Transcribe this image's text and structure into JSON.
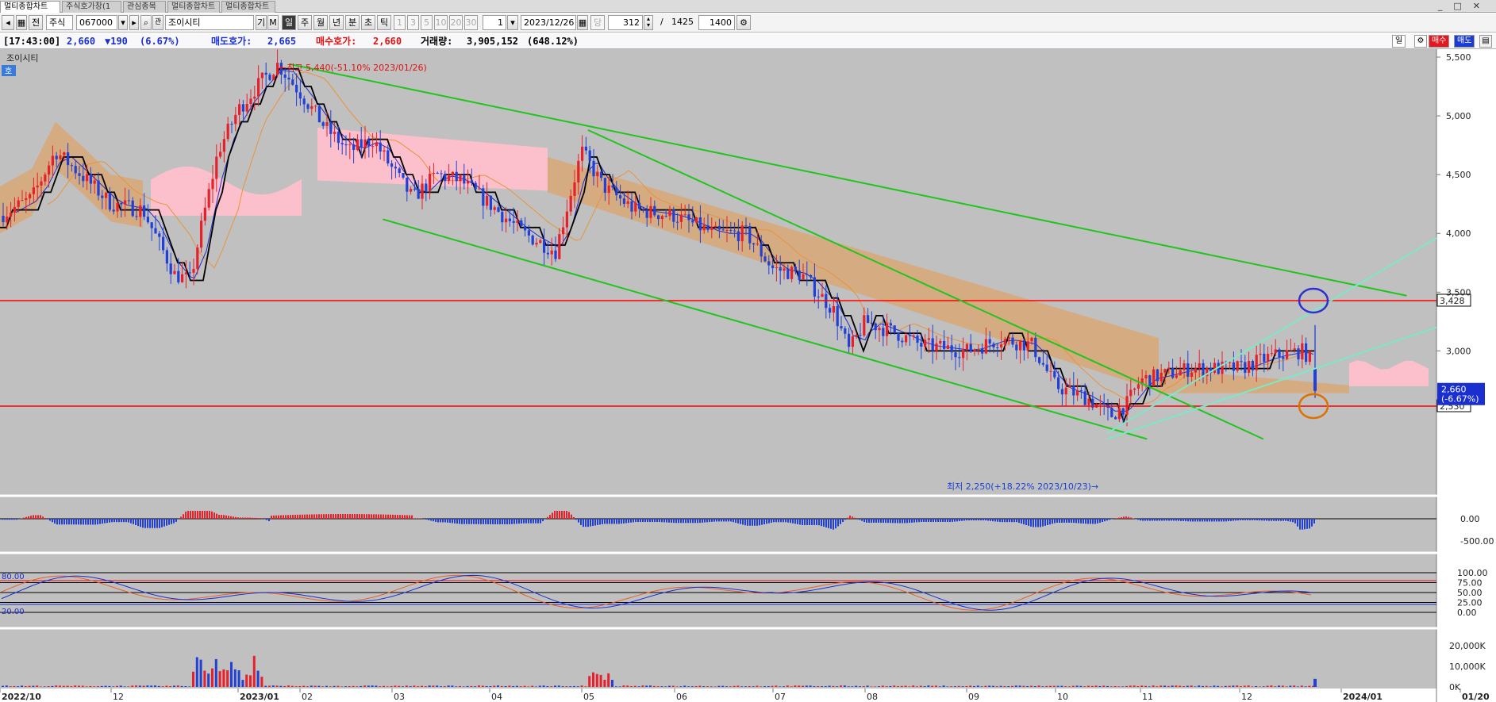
{
  "tabs": [
    {
      "label": "멀티종합차트"
    },
    {
      "label": "주식호가창(1"
    },
    {
      "label": "관심종목"
    },
    {
      "label": "멀티종합차트"
    },
    {
      "label": "멀티종합차트"
    }
  ],
  "toolbar": {
    "prev_label": "전",
    "market": "주식",
    "code": "067000",
    "name": "조이시티",
    "info_btn": "기",
    "m_btn": "M",
    "periods": [
      "일",
      "주",
      "월",
      "년",
      "분",
      "초",
      "틱"
    ],
    "active_period": "일",
    "intervals": [
      "1",
      "3",
      "5",
      "10",
      "20",
      "30"
    ],
    "unit": "1",
    "date": "2023/12/26",
    "dang": "당",
    "count": "312",
    "slash": "/",
    "total": "1425",
    "display": "1400"
  },
  "info": {
    "time": "[17:43:00]",
    "price": "2,660",
    "change": "▼190",
    "change_pct": "(6.67%)",
    "ask_label": "매도호가:",
    "ask": "2,665",
    "bid_label": "매수호가:",
    "bid": "2,660",
    "vol_label": "거래량:",
    "volume": "3,905,152",
    "vol_pct": "(648.12%)",
    "daily_btn": "일",
    "buy_btn": "매수",
    "sell_btn": "매도"
  },
  "colors": {
    "background": "#c0c0c0",
    "up": "#e8202a",
    "down": "#2040d8",
    "trendline": "#22c41e",
    "channel": "#7de8c8",
    "support_resistance": "#ff0000",
    "cloud_bear": "#d7a87a",
    "cloud_bull": "#ffc0cc",
    "kijun": "#000000",
    "ma_long": "#e8943a",
    "ma_mid": "#1c2ed0"
  },
  "chart_data": [
    {
      "type": "candlestick",
      "title": "조이시티",
      "series_tag": "호",
      "ylim": [
        2250,
        5600
      ],
      "y_ticks": [
        3000,
        3500,
        4000,
        4500,
        5000,
        5500
      ],
      "y_tick_labels": [
        "3,000",
        "3,500",
        "4,000",
        "4,500",
        "5,000",
        "5,500"
      ],
      "x_ticks": [
        "2022/10",
        "12",
        "2023/01",
        "02",
        "03",
        "04",
        "05",
        "06",
        "07",
        "08",
        "09",
        "10",
        "11",
        "12",
        "2024/01",
        "01/20"
      ],
      "ohlc_key_points": [
        {
          "date": "2022/10",
          "close": 4150
        },
        {
          "date": "2022/11",
          "close": 4700
        },
        {
          "date": "2022/12 mid",
          "close": 3600
        },
        {
          "date": "2023/01/26",
          "high": 5440
        },
        {
          "date": "2023/02",
          "close": 4950
        },
        {
          "date": "2023/03",
          "close": 4550
        },
        {
          "date": "2023/04",
          "close": 3850
        },
        {
          "date": "2023/05",
          "close": 4700
        },
        {
          "date": "2023/06",
          "close": 4100
        },
        {
          "date": "2023/07",
          "close": 3600
        },
        {
          "date": "2023/08",
          "close": 3150
        },
        {
          "date": "2023/09",
          "close": 3000
        },
        {
          "date": "2023/10/23",
          "low": 2250
        },
        {
          "date": "2023/11",
          "close": 2750
        },
        {
          "date": "2023/12",
          "close": 2950
        },
        {
          "date": "2023/12/26",
          "open": 2850,
          "high": 3220,
          "low": 2600,
          "close": 2660
        }
      ],
      "horizontal_lines": [
        {
          "value": 3428,
          "label": "3,428"
        },
        {
          "value": 2530,
          "label": "2,530"
        }
      ],
      "current_price": {
        "value": 2660,
        "label": "2,660",
        "sub_label": "(-6.67%)"
      },
      "annotations": [
        {
          "text": "←최고 5,440(-51.10% 2023/01/26)",
          "date": "2023/01/26",
          "value": 5440
        },
        {
          "text": "최저 2,250(+18.22% 2023/10/23)→",
          "date": "2023/10/23",
          "value": 2250
        }
      ],
      "trendlines": [
        {
          "from": {
            "date": "2023/01/26",
            "value": 5440
          },
          "to": {
            "date": "2024/01/20",
            "value": 3470
          }
        },
        {
          "from": {
            "date": "2023/05/03",
            "value": 4880
          },
          "to": {
            "date": "2023/12/08",
            "value": 2250
          }
        },
        {
          "from": {
            "date": "2023/02/28",
            "value": 4120
          },
          "to": {
            "date": "2023/11/03",
            "value": 2250
          }
        }
      ],
      "circles": [
        {
          "date": "2023/12/26",
          "value": 3428,
          "color": "#3030d0"
        },
        {
          "date": "2023/12/26",
          "value": 2530,
          "color": "#e07000"
        }
      ]
    },
    {
      "type": "histogram",
      "name": "MACD Oscillator",
      "y_ticks": [
        0,
        -500
      ],
      "y_tick_labels": [
        "0.00",
        "-500.00"
      ]
    },
    {
      "type": "line",
      "name": "Stochastic",
      "ylim": [
        0,
        100
      ],
      "y_ticks": [
        100,
        75,
        50,
        25,
        0
      ],
      "y_tick_labels": [
        "100.00",
        "75.00",
        "50.00",
        "25.00",
        "0.00"
      ],
      "levels": [
        {
          "value": 80,
          "label": "80.00"
        },
        {
          "value": 20,
          "label": "20.00"
        }
      ]
    },
    {
      "type": "bar",
      "name": "Volume",
      "y_ticks": [
        20000,
        10000,
        0
      ],
      "y_tick_labels": [
        "20,000K",
        "10,000K",
        "0K"
      ],
      "last_value": 3905152
    }
  ]
}
